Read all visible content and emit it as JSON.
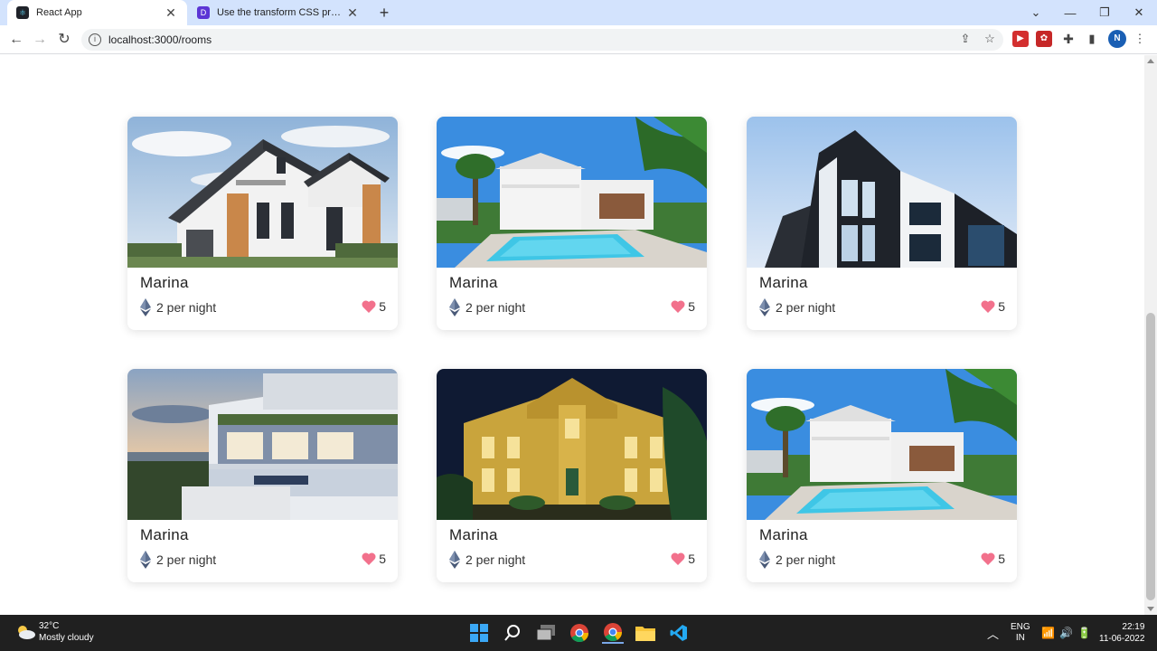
{
  "browser": {
    "tabs": [
      {
        "title": "React App",
        "active": true
      },
      {
        "title": "Use the transform CSS property t",
        "active": false
      }
    ],
    "new_tab_symbol": "+",
    "url": "localhost:3000/rooms",
    "profile_initial": "N"
  },
  "rooms": [
    {
      "name": "Marina",
      "price": "2 per night",
      "likes": "5",
      "photo": "modern-gabled-house-photo"
    },
    {
      "name": "Marina",
      "price": "2 per night",
      "likes": "5",
      "photo": "villa-with-pool-photo"
    },
    {
      "name": "Marina",
      "price": "2 per night",
      "likes": "5",
      "photo": "dark-modern-building-photo"
    },
    {
      "name": "Marina",
      "price": "2 per night",
      "likes": "5",
      "photo": "rooftop-terrace-photo"
    },
    {
      "name": "Marina",
      "price": "2 per night",
      "likes": "5",
      "photo": "lit-mansion-night-photo"
    },
    {
      "name": "Marina",
      "price": "2 per night",
      "likes": "5",
      "photo": "villa-with-pool-photo"
    }
  ],
  "taskbar": {
    "weather_temp": "32°C",
    "weather_desc": "Mostly cloudy",
    "lang_top": "ENG",
    "lang_bottom": "IN",
    "time": "22:19",
    "date": "11-06-2022"
  },
  "colors": {
    "tabbar": "#d3e3fd",
    "heart": "#f2718c",
    "eth": "#5b6e8f",
    "taskbar": "#202020"
  }
}
